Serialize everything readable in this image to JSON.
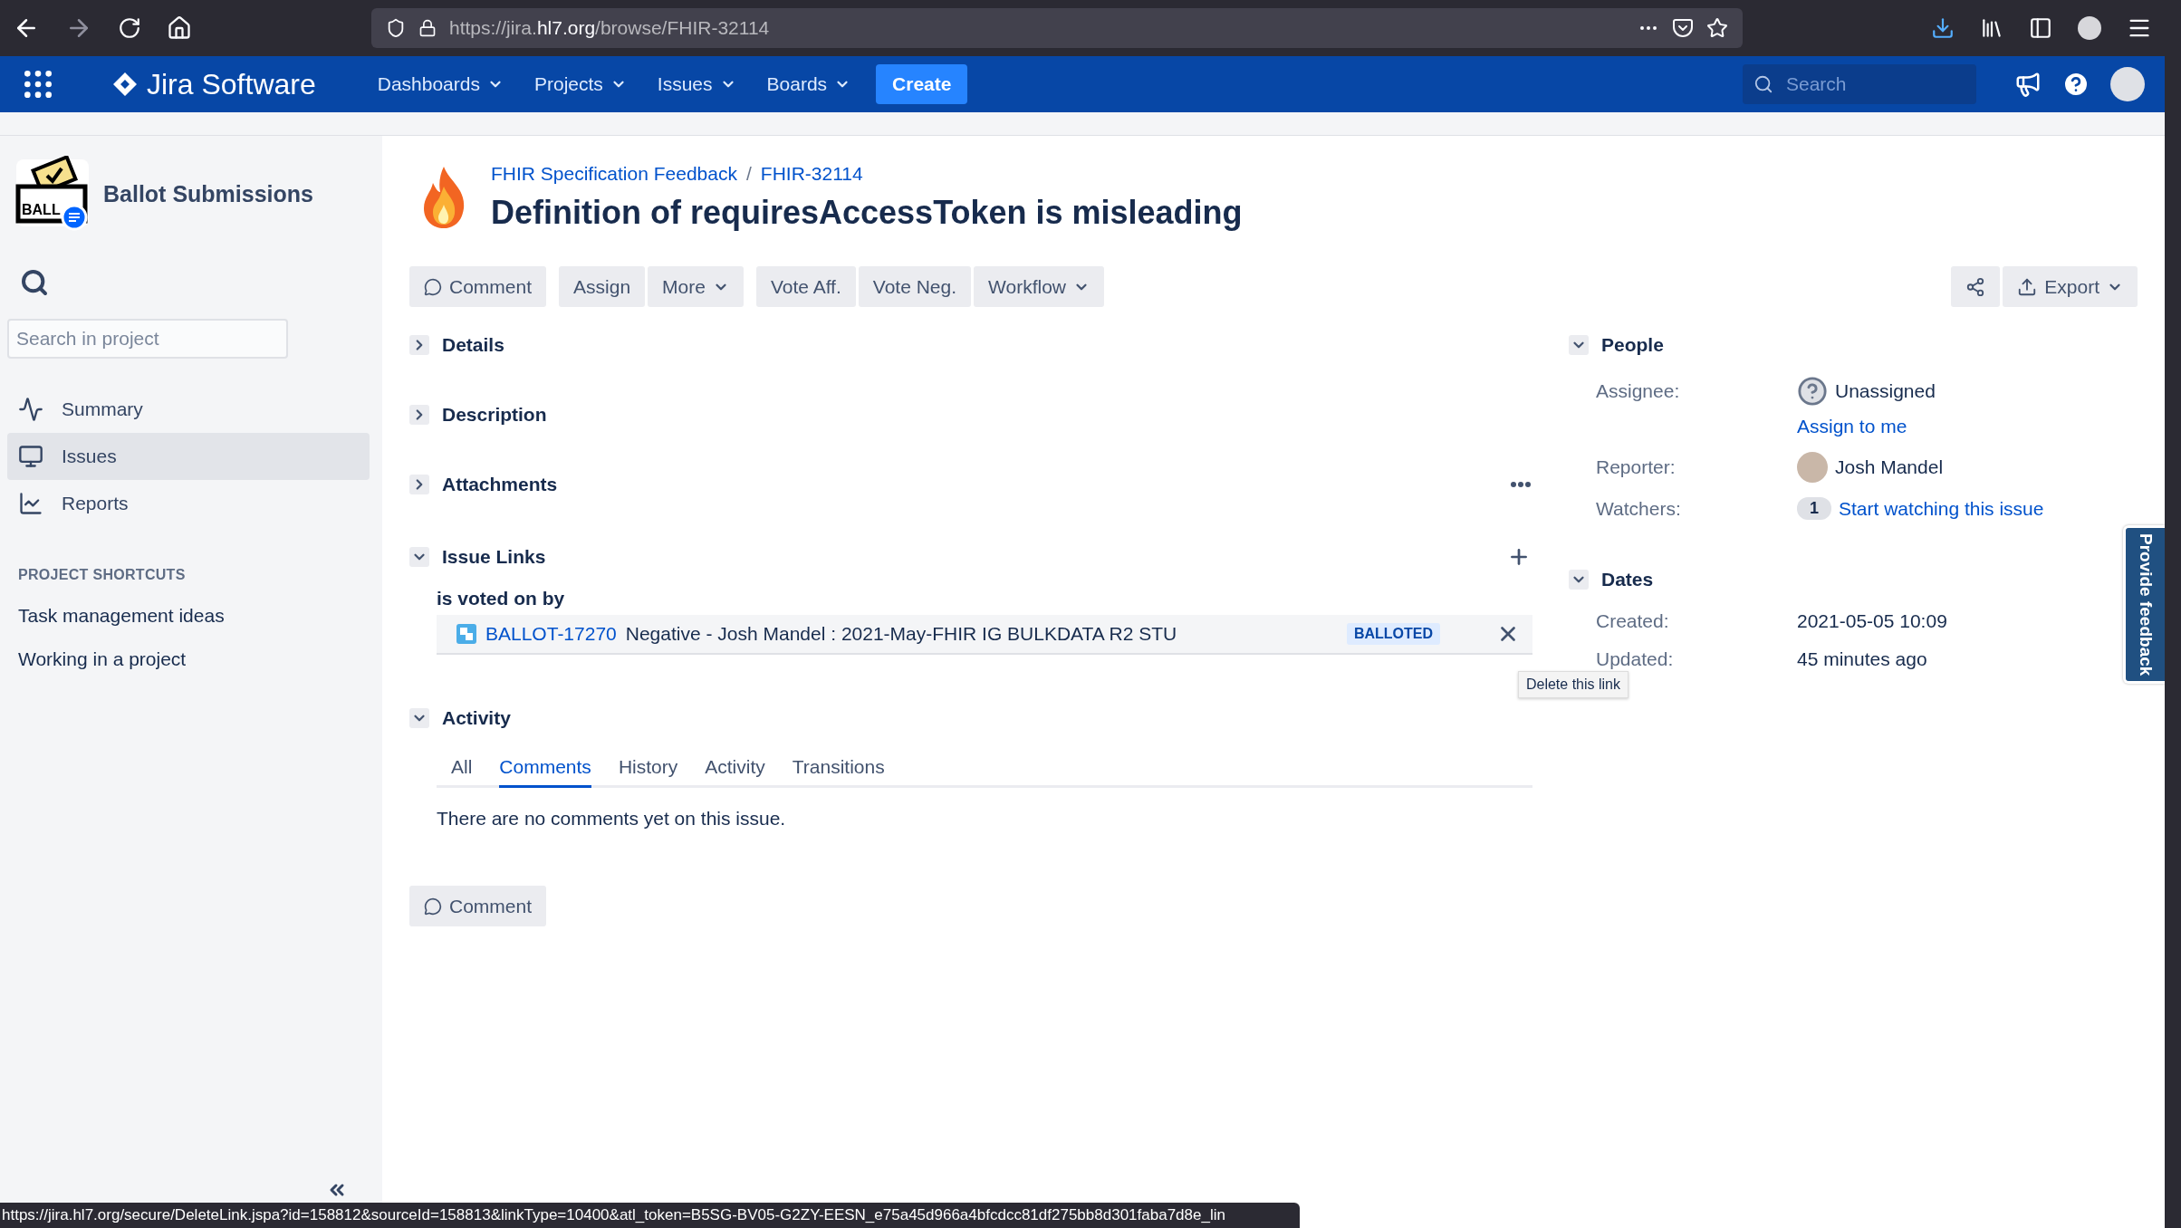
{
  "browser": {
    "url": "https://jira.**hl7.org**/browse/FHIR-32114"
  },
  "nav": {
    "product": "Jira Software",
    "menus": [
      {
        "label": "Dashboards"
      },
      {
        "label": "Projects"
      },
      {
        "label": "Issues"
      },
      {
        "label": "Boards"
      }
    ],
    "create": "Create",
    "search": {
      "placeholder": "Search"
    }
  },
  "sidebar": {
    "logo_text": "BALL",
    "project": "Ballot Submissions",
    "search": {
      "placeholder": "Search in project"
    },
    "items": [
      {
        "label": "Summary",
        "kind": "summary",
        "selected": false
      },
      {
        "label": "Issues",
        "kind": "issues",
        "selected": true
      },
      {
        "label": "Reports",
        "kind": "reports",
        "selected": false
      }
    ],
    "shortcuts_heading": "PROJECT SHORTCUTS",
    "shortcuts": [
      "Task management ideas",
      "Working in a project"
    ]
  },
  "issue": {
    "breadcrumbs": [
      "FHIR Specification Feedback",
      "FHIR-32114"
    ],
    "breadcrumb_separator": "/",
    "title": "Definition of requiresAccessToken is misleading",
    "toolbar": [
      [
        {
          "label": "Comment",
          "kind": "comment"
        }
      ],
      [
        {
          "label": "Assign",
          "kind": "plain"
        },
        {
          "label": "More",
          "kind": "dropdown"
        }
      ],
      [
        {
          "label": "Vote Aff.",
          "kind": "plain"
        },
        {
          "label": "Vote Neg.",
          "kind": "plain"
        },
        {
          "label": "Workflow",
          "kind": "dropdown"
        }
      ]
    ],
    "export": "Export",
    "sections": [
      {
        "title": "Details",
        "expanded": false,
        "menu": false
      },
      {
        "title": "Description",
        "expanded": false,
        "menu": false
      },
      {
        "title": "Attachments",
        "expanded": false,
        "menu": true
      }
    ],
    "issue_links": {
      "title": "Issue Links",
      "expanded": true,
      "groups": [
        {
          "label": "is voted on by",
          "links": [
            {
              "key": "BALLOT-17270",
              "summary": "Negative - Josh Mandel : 2021-May-FHIR IG BULKDATA R2 STU",
              "status": "BALLOTED"
            }
          ]
        }
      ],
      "tooltip": "Delete this link"
    },
    "activity": {
      "title": "Activity",
      "expanded": true,
      "tabs": [
        {
          "label": "All",
          "selected": false
        },
        {
          "label": "Comments",
          "selected": true
        },
        {
          "label": "History",
          "selected": false
        },
        {
          "label": "Activity",
          "selected": false
        },
        {
          "label": "Transitions",
          "selected": false
        }
      ],
      "empty": "There are no comments yet on this issue.",
      "comment": "Comment"
    }
  },
  "people": {
    "title": "People",
    "expanded": true,
    "assignee_label": "Assignee:",
    "assignee": "Unassigned",
    "assign_to_me": "Assign to me",
    "reporter_label": "Reporter:",
    "reporter": "Josh Mandel",
    "watchers_label": "Watchers:",
    "watchers_count": "1",
    "watch_link": "Start watching this issue"
  },
  "dates": {
    "title": "Dates",
    "expanded": true,
    "fields": [
      {
        "label": "Created:",
        "value": "2021-05-05 10:09"
      },
      {
        "label": "Updated:",
        "value": "45 minutes ago"
      }
    ]
  },
  "feedback": "Provide feedback",
  "status_url": "https://jira.hl7.org/secure/DeleteLink.jspa?id=158812&sourceId=158813&linkType=10400&atl_token=B5SG-BV05-G2ZY-EESN_e75a45d966a4bfcdcc81df275bb8d301faba7d8e_lin"
}
